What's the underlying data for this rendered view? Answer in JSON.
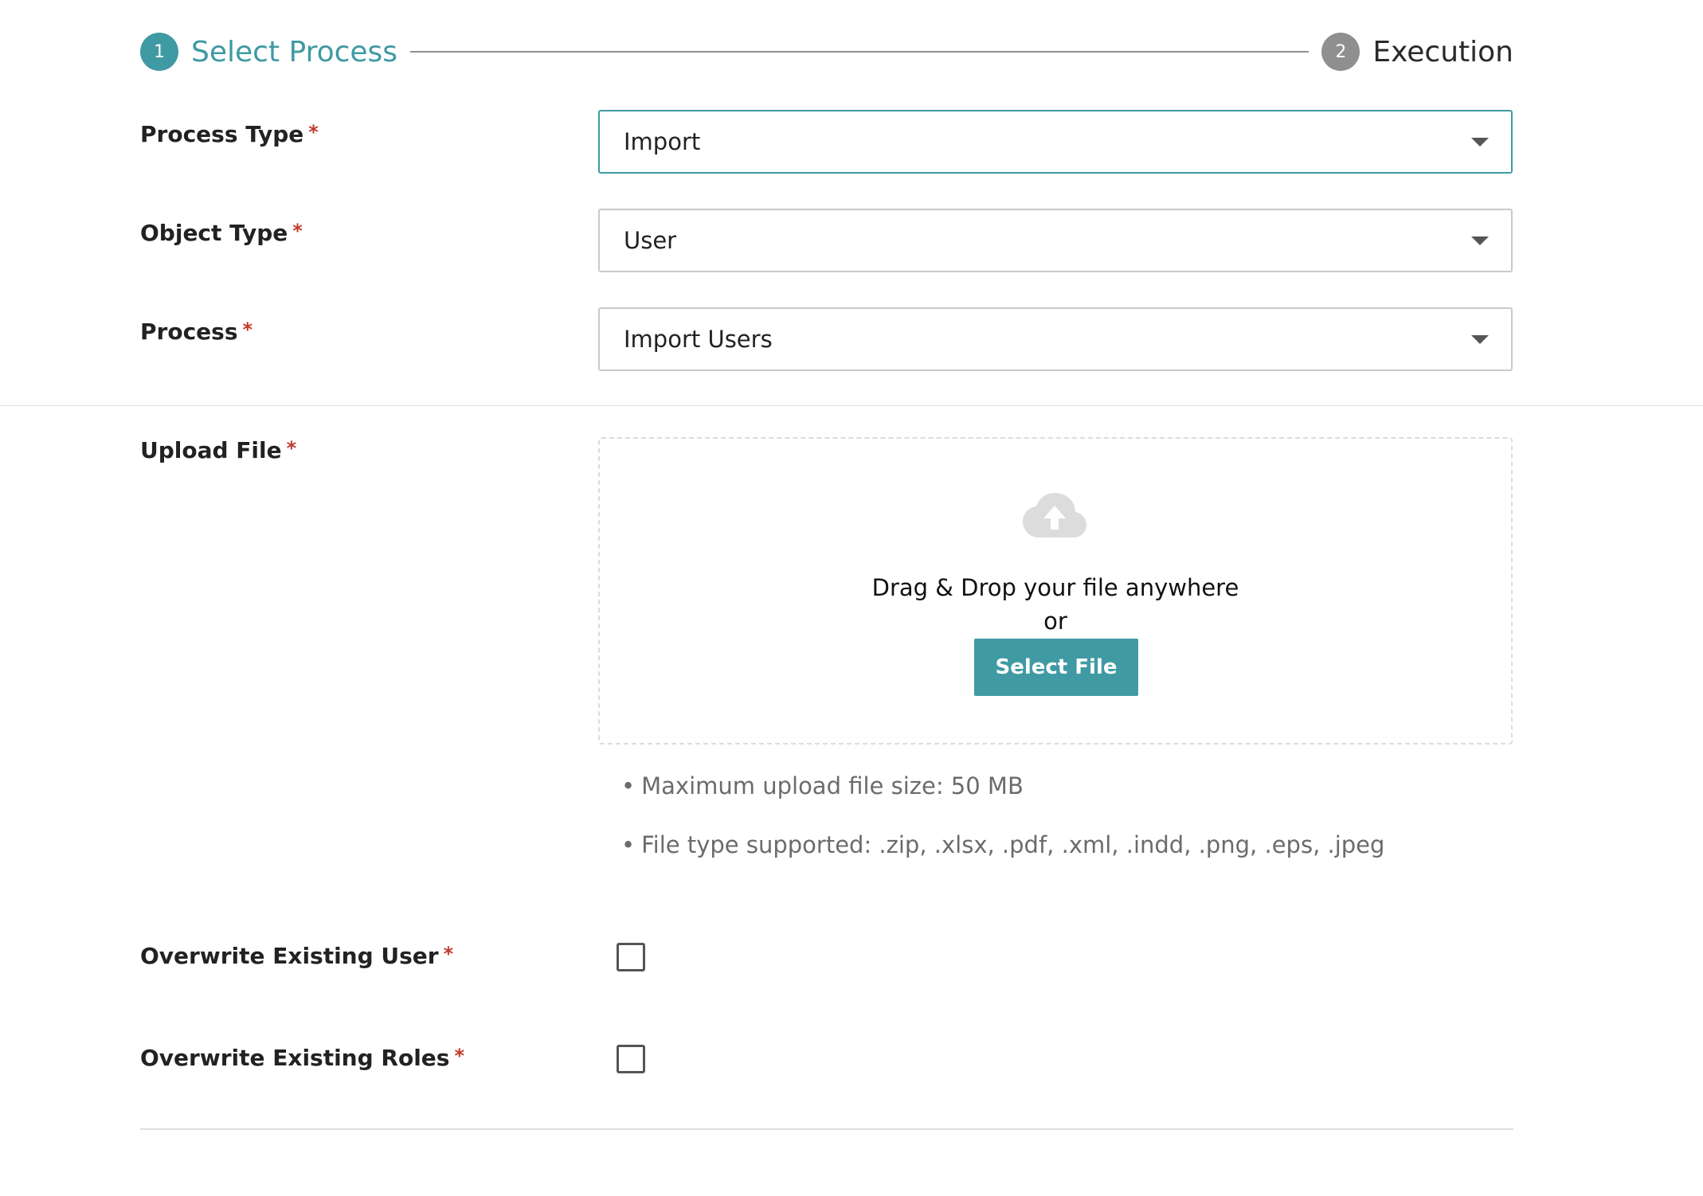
{
  "stepper": {
    "steps": [
      {
        "number": "1",
        "label": "Select Process",
        "state": "active"
      },
      {
        "number": "2",
        "label": "Execution",
        "state": "inactive"
      }
    ]
  },
  "form": {
    "required_marker": "*",
    "process_type": {
      "label": "Process Type",
      "value": "Import"
    },
    "object_type": {
      "label": "Object Type",
      "value": "User"
    },
    "process": {
      "label": "Process",
      "value": "Import Users"
    },
    "upload": {
      "label": "Upload File",
      "drop_text": "Drag & Drop your file anywhere",
      "or_text": "or",
      "button_label": "Select File",
      "hints": [
        "Maximum upload file size: 50 MB",
        "File type supported: .zip, .xlsx, .pdf, .xml, .indd, .png, .eps, .jpeg"
      ],
      "bullet": "•"
    },
    "overwrite_user": {
      "label": "Overwrite Existing User",
      "checked": false
    },
    "overwrite_roles": {
      "label": "Overwrite Existing Roles",
      "checked": false
    }
  },
  "colors": {
    "accent": "#3f9aa3",
    "required": "#c0392b",
    "inactive_step": "#8f8f8f",
    "hint_text": "#6b6b6b"
  },
  "icons": {
    "upload": "cloud-upload-icon",
    "dropdown": "chevron-down-icon"
  }
}
